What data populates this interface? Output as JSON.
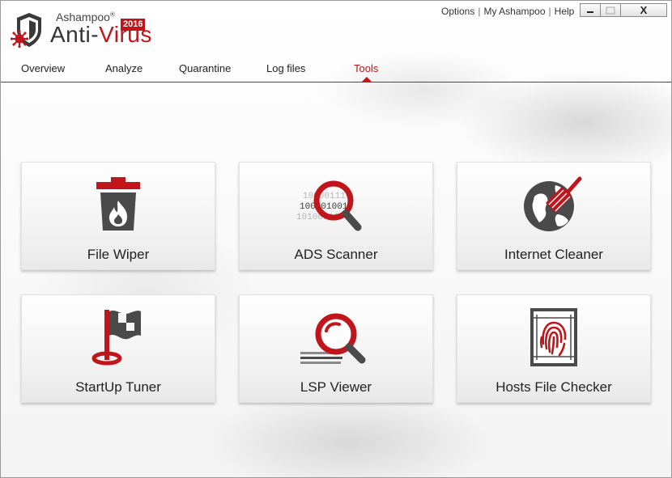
{
  "app": {
    "brand": "Ashampoo",
    "brand_mark": "®",
    "product_prefix": "Anti-",
    "product_suffix": "Virus",
    "year": "2016"
  },
  "toplinks": {
    "options": "Options",
    "sep1": "|",
    "my_ashampoo": "My Ashampoo",
    "sep2": "|",
    "help": "Help"
  },
  "window_controls": {
    "minimize": "minimize",
    "maximize": "maximize",
    "close": "X"
  },
  "tabs": [
    {
      "label": "Overview",
      "active": false
    },
    {
      "label": "Analyze",
      "active": false
    },
    {
      "label": "Quarantine",
      "active": false
    },
    {
      "label": "Log files",
      "active": false
    },
    {
      "label": "Tools",
      "active": true
    }
  ],
  "tools": [
    {
      "label": "File Wiper",
      "icon": "trash-fire-icon"
    },
    {
      "label": "ADS Scanner",
      "icon": "binary-magnifier-icon"
    },
    {
      "label": "Internet Cleaner",
      "icon": "globe-broom-icon"
    },
    {
      "label": "StartUp Tuner",
      "icon": "flag-icon"
    },
    {
      "label": "LSP Viewer",
      "icon": "magnifier-lines-icon"
    },
    {
      "label": "Hosts File Checker",
      "icon": "fingerprint-icon"
    }
  ],
  "ads_binary": [
    "100001110",
    "100001001",
    "101001110"
  ],
  "colors": {
    "accent": "#c0151b",
    "dark_gray": "#4a4a4a",
    "tile_bg": "#f1f1f1"
  }
}
